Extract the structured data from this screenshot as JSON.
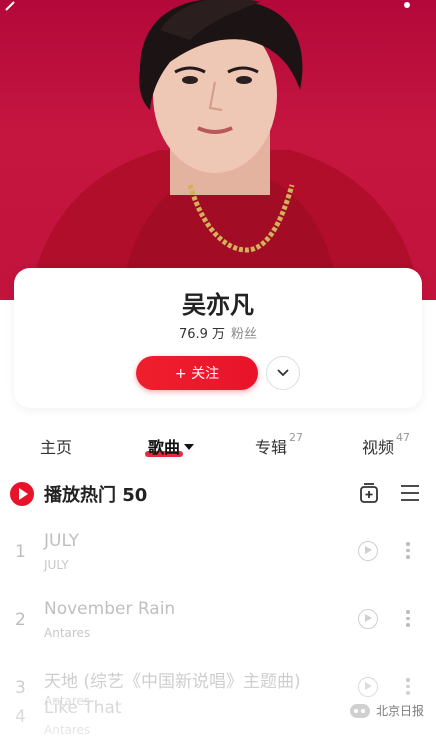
{
  "artist": {
    "name": "吴亦凡",
    "fans_count": "76.9 万",
    "fans_label": "粉丝",
    "follow_label": "+ 关注"
  },
  "tabs": [
    {
      "label": "主页",
      "count": ""
    },
    {
      "label": "歌曲",
      "count": ""
    },
    {
      "label": "专辑",
      "count": "27"
    },
    {
      "label": "视频",
      "count": "47"
    }
  ],
  "playlist": {
    "title": "播放热门 50"
  },
  "songs": [
    {
      "num": "1",
      "title": "JULY",
      "artist": "JULY"
    },
    {
      "num": "2",
      "title": "November Rain",
      "artist": "Antares"
    },
    {
      "num": "3",
      "title": "天地 (综艺《中国新说唱》主题曲)",
      "artist": "Antares"
    },
    {
      "num": "4",
      "title": "Like That",
      "artist": "Antares"
    }
  ],
  "watermark": "北京日报",
  "colors": {
    "accent": "#e6132a",
    "hero_bg": "#c1133c"
  },
  "icons": [
    "back-arrow-icon",
    "more-dots-icon",
    "chevron-down-icon",
    "play-circle-icon",
    "add-to-list-icon",
    "list-icon",
    "play-small-icon",
    "vertical-more-icon"
  ]
}
